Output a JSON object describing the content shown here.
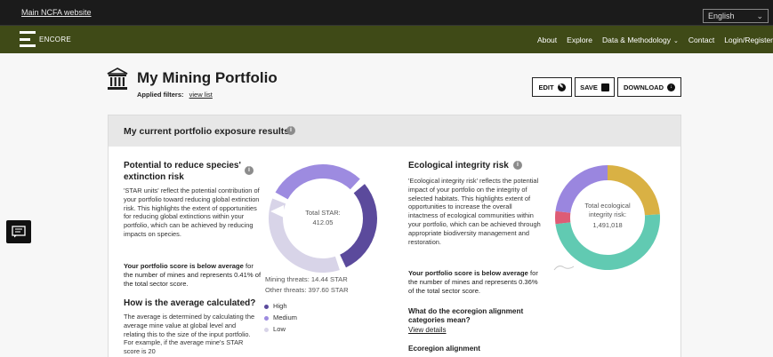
{
  "topbar": {
    "ncfa_link": "Main NCFA website",
    "language": "English"
  },
  "nav": {
    "brand": "ENCORE",
    "items": [
      "About",
      "Explore",
      "Data & Methodology",
      "Contact",
      "Login/Register"
    ]
  },
  "header": {
    "title": "My Mining Portfolio",
    "filters_label": "Applied filters:",
    "view_list": "view list",
    "edit": "EDIT",
    "save": "SAVE",
    "download": "DOWNLOAD"
  },
  "card": {
    "title": "My current portfolio exposure results",
    "species": {
      "heading": "Potential to reduce species' extinction risk",
      "description": "'STAR units' reflect the potential contribution of your portfolio toward reducing global extinction risk. This highlights the extent of opportunities for reducing global extinctions within your portfolio, which can be achieved by reducing impacts on species.",
      "score_bold": "Your portfolio score is below average",
      "score_rest": "for the number of mines and represents 0.41% of the total sector score.",
      "avg_heading": "How is the average calculated?",
      "avg_text": "The average is determined by calculating the average mine value at global level and relating this to the size of the input portfolio. For example, if the average mine's STAR score is 20",
      "donut_label": "Total STAR:",
      "donut_value": "412.05",
      "mining_threats": "Mining threats: 14.44 STAR",
      "other_threats": "Other threats: 397.60 STAR",
      "legend": [
        {
          "label": "High",
          "color": "#5b4a9c"
        },
        {
          "label": "Medium",
          "color": "#9d8be0"
        },
        {
          "label": "Low",
          "color": "#d8d4e8"
        }
      ],
      "segments": [
        {
          "level": "Medium",
          "from": 0.83,
          "to": 0.12,
          "color": "#9d8be0"
        },
        {
          "level": "High",
          "from": 0.14,
          "to": 0.43,
          "color": "#5b4a9c"
        },
        {
          "level": "Low",
          "from": 0.45,
          "to": 0.81,
          "color": "#d8d4e8"
        }
      ]
    },
    "integrity": {
      "heading": "Ecological integrity risk",
      "description": "'Ecological integrity risk' reflects the potential impact of your portfolio on the integrity of selected habitats. This highlights extent of opportunities to increase the overall intactness of ecological communities within your portfolio, which can be achieved through appropriate biodiversity management and restoration.",
      "score_bold": "Your portfolio score is below average",
      "score_rest": "for the number of mines and represents 0.36% of the total sector score.",
      "q_heading": "What do the ecoregion alignment categories mean?",
      "view_details": "View details",
      "eco_heading": "Ecoregion alignment",
      "donut_label": "Total ecological integrity risk:",
      "donut_value": "1,491,018",
      "segments": [
        {
          "from": 0.0,
          "to": 0.24,
          "color": "#d9b144"
        },
        {
          "from": 0.24,
          "to": 0.73,
          "color": "#61cab2"
        },
        {
          "from": 0.73,
          "to": 0.77,
          "color": "#de5c76"
        },
        {
          "from": 0.77,
          "to": 1.0,
          "color": "#9a86df"
        }
      ]
    }
  }
}
